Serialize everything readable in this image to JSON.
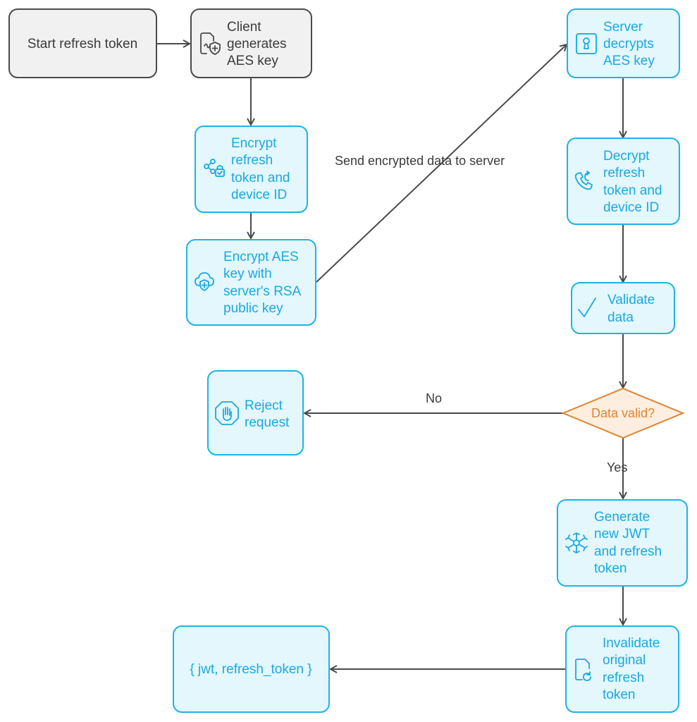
{
  "diagram": {
    "title": "",
    "colors": {
      "start_fill": "#f1f1f1",
      "start_stroke": "#4a4a4a",
      "process_fill": "#e3f7fd",
      "process_stroke": "#1fb3e5",
      "process_text": "#1aa9df",
      "decision_fill": "#fdeee0",
      "decision_stroke": "#e0832f",
      "edge": "#4a4a4a"
    },
    "nodes": {
      "start": {
        "lines": [
          "Start refresh token"
        ],
        "icon": null
      },
      "gen_aes": {
        "lines": [
          "Client",
          "generates",
          "AES key"
        ],
        "icon": "file-shield-icon"
      },
      "encrypt_token": {
        "lines": [
          "Encrypt",
          "refresh",
          "token and",
          "device ID"
        ],
        "icon": "share-lock-icon"
      },
      "encrypt_aes": {
        "lines": [
          "Encrypt AES",
          "key with",
          "server's RSA",
          "public key"
        ],
        "icon": "cloud-shield-icon"
      },
      "server_decrypt": {
        "lines": [
          "Server",
          "decrypts",
          "AES key"
        ],
        "icon": "keyhole-icon"
      },
      "decrypt_token": {
        "lines": [
          "Decrypt",
          "refresh",
          "token and",
          "device ID"
        ],
        "icon": "phone-refresh-icon"
      },
      "validate": {
        "lines": [
          "Validate",
          "data"
        ],
        "icon": "check-icon"
      },
      "decision": {
        "lines": [
          "Data valid?"
        ]
      },
      "reject": {
        "lines": [
          "Reject",
          "request"
        ],
        "icon": "stop-hand-icon"
      },
      "generate_jwt": {
        "lines": [
          "Generate",
          "new JWT",
          "and refresh",
          "token"
        ],
        "icon": "snowflake-icon"
      },
      "invalidate": {
        "lines": [
          "Invalidate",
          "original",
          "refresh",
          "token"
        ],
        "icon": "file-refresh-icon"
      },
      "result": {
        "lines": [
          "{ jwt, refresh_token }"
        ],
        "icon": null
      }
    },
    "edges": [
      {
        "from": "start",
        "to": "gen_aes",
        "label": ""
      },
      {
        "from": "gen_aes",
        "to": "encrypt_token",
        "label": ""
      },
      {
        "from": "encrypt_token",
        "to": "encrypt_aes",
        "label": ""
      },
      {
        "from": "encrypt_aes",
        "to": "server_decrypt",
        "label": "Send encrypted data to server"
      },
      {
        "from": "server_decrypt",
        "to": "decrypt_token",
        "label": ""
      },
      {
        "from": "decrypt_token",
        "to": "validate",
        "label": ""
      },
      {
        "from": "validate",
        "to": "decision",
        "label": ""
      },
      {
        "from": "decision",
        "to": "reject",
        "label": "No"
      },
      {
        "from": "decision",
        "to": "generate_jwt",
        "label": "Yes"
      },
      {
        "from": "generate_jwt",
        "to": "invalidate",
        "label": ""
      },
      {
        "from": "invalidate",
        "to": "result",
        "label": ""
      }
    ]
  }
}
